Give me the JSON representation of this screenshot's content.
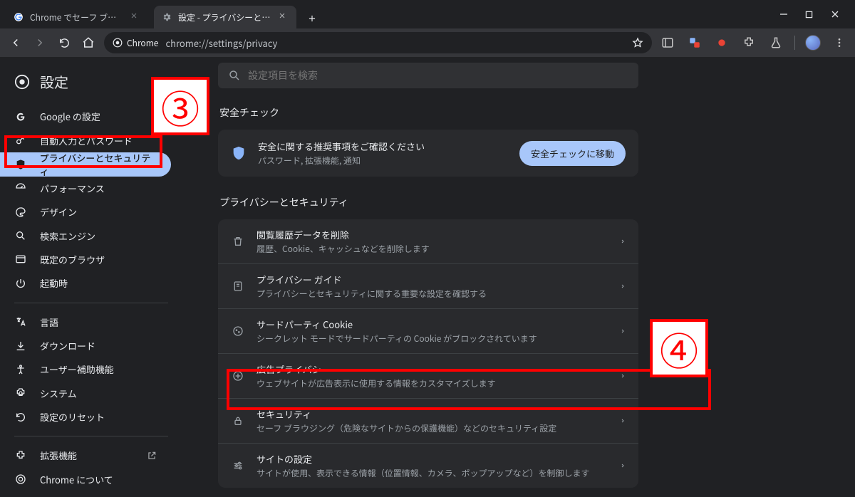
{
  "browser": {
    "tabs": [
      {
        "title": "Chrome でセーフ ブラウジングの保護",
        "active": false
      },
      {
        "title": "設定 - プライバシーとセキュリティ",
        "active": true
      }
    ],
    "omnibox_chip": "Chrome",
    "url": "chrome://settings/privacy"
  },
  "sidebar": {
    "title": "設定",
    "items_primary": [
      {
        "icon": "google",
        "label": "Google の設定"
      },
      {
        "icon": "key",
        "label": "自動入力とパスワード"
      },
      {
        "icon": "shield",
        "label": "プライバシーとセキュリティ",
        "active": true
      },
      {
        "icon": "gauge",
        "label": "パフォーマンス"
      },
      {
        "icon": "palette",
        "label": "デザイン"
      },
      {
        "icon": "search",
        "label": "検索エンジン"
      },
      {
        "icon": "browser",
        "label": "既定のブラウザ"
      },
      {
        "icon": "power",
        "label": "起動時"
      }
    ],
    "items_secondary": [
      {
        "icon": "lang",
        "label": "言語"
      },
      {
        "icon": "download",
        "label": "ダウンロード"
      },
      {
        "icon": "accessibility",
        "label": "ユーザー補助機能"
      },
      {
        "icon": "system",
        "label": "システム"
      },
      {
        "icon": "reset",
        "label": "設定のリセット"
      }
    ],
    "items_footer": [
      {
        "icon": "extension",
        "label": "拡張機能",
        "external": true
      },
      {
        "icon": "chrome",
        "label": "Chrome について"
      }
    ]
  },
  "main": {
    "search_placeholder": "設定項目を検索",
    "safety_section_title": "安全チェック",
    "safety_card": {
      "title": "安全に関する推奨事項をご確認ください",
      "subtitle": "パスワード, 拡張機能, 通知",
      "button": "安全チェックに移動"
    },
    "privacy_section_title": "プライバシーとセキュリティ",
    "rows": [
      {
        "icon": "trash",
        "title": "閲覧履歴データを削除",
        "subtitle": "履歴、Cookie、キャッシュなどを削除します"
      },
      {
        "icon": "guide",
        "title": "プライバシー ガイド",
        "subtitle": "プライバシーとセキュリティに関する重要な設定を確認する"
      },
      {
        "icon": "cookie",
        "title": "サードパーティ Cookie",
        "subtitle": "シークレット モードでサードパーティの Cookie がブロックされています"
      },
      {
        "icon": "ads",
        "title": "広告プライバシー",
        "subtitle": "ウェブサイトが広告表示に使用する情報をカスタマイズします"
      },
      {
        "icon": "lock",
        "title": "セキュリティ",
        "subtitle": "セーフ ブラウジング（危険なサイトからの保護機能）などのセキュリティ設定"
      },
      {
        "icon": "tune",
        "title": "サイトの設定",
        "subtitle": "サイトが使用、表示できる情報（位置情報、カメラ、ポップアップなど）を制御します"
      }
    ]
  },
  "annotations": {
    "three": "③",
    "four": "④"
  }
}
